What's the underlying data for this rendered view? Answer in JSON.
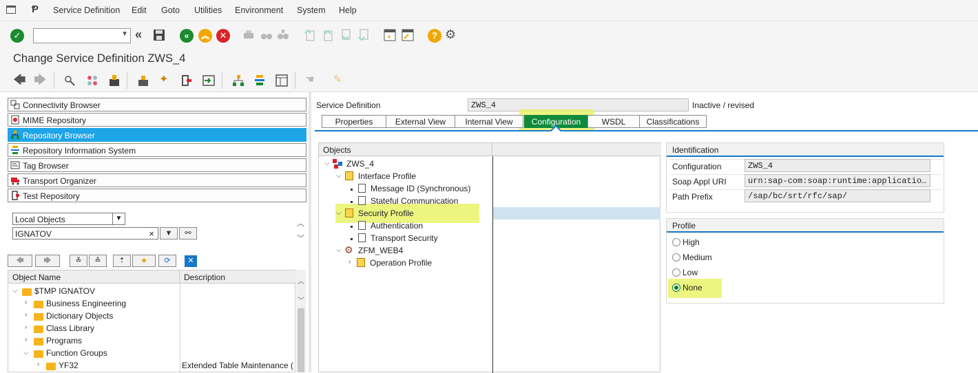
{
  "menu": {
    "items": [
      "Service Definition",
      "Edit",
      "Goto",
      "Utilities",
      "Environment",
      "System",
      "Help"
    ]
  },
  "toolbar": {
    "command_value": "",
    "icons": [
      "enter-icon",
      "command-dropdown-icon",
      "back-double-icon",
      "save-icon",
      "back-icon",
      "exit-icon",
      "cancel-icon",
      "print-icon",
      "find-icon",
      "find-next-icon",
      "first-page-icon",
      "previous-page-icon",
      "next-page-icon",
      "last-page-icon",
      "new-session-icon",
      "shortcut-icon",
      "help-icon",
      "settings-gear-icon"
    ]
  },
  "title": "Change Service Definition ZWS_4",
  "app_toolbar": {
    "icons": [
      "back-arrow-icon",
      "forward-arrow-icon",
      "other-object-icon",
      "display-change-icon",
      "activate-icon",
      "check-icon",
      "where-used-icon",
      "object-list-icon",
      "hierarchy-icon",
      "navigation-window-icon",
      "info-icon",
      "edit-lock-icon"
    ]
  },
  "nav": {
    "items": [
      {
        "label": "Connectivity Browser",
        "icon": "connectivity-icon"
      },
      {
        "label": "MIME Repository",
        "icon": "mime-icon"
      },
      {
        "label": "Repository Browser",
        "icon": "repository-icon"
      },
      {
        "label": "Repository Information System",
        "icon": "info-system-icon"
      },
      {
        "label": "Tag Browser",
        "icon": "tag-icon"
      },
      {
        "label": "Transport Organizer",
        "icon": "transport-icon"
      },
      {
        "label": "Test Repository",
        "icon": "test-icon"
      }
    ],
    "object_type_value": "Local Objects",
    "object_name_value": "IGNATOV",
    "clear_symbol": "×"
  },
  "left_tree": {
    "col_object": "Object Name",
    "col_description": "Description",
    "rows": [
      {
        "label": "$TMP IGNATOV",
        "desc": ""
      },
      {
        "label": "Business Engineering",
        "desc": ""
      },
      {
        "label": "Dictionary Objects",
        "desc": ""
      },
      {
        "label": "Class Library",
        "desc": ""
      },
      {
        "label": "Programs",
        "desc": ""
      },
      {
        "label": "Function Groups",
        "desc": ""
      },
      {
        "label": "YF32",
        "desc": "Extended Table Maintenance ("
      }
    ]
  },
  "header": {
    "label": "Service Definition",
    "value": "ZWS_4",
    "status": "Inactive / revised"
  },
  "tabs": [
    "Properties",
    "External View",
    "Internal View",
    "Configuration",
    "WSDL",
    "Classifications"
  ],
  "objects": {
    "header": "Objects",
    "rows": [
      "ZWS_4",
      "Interface Profile",
      "Message ID (Synchronous)",
      "Stateful Communication",
      "Security Profile",
      "Authentication",
      "Transport Security",
      "ZFM_WEB4",
      "Operation Profile"
    ]
  },
  "identification": {
    "title": "Identification",
    "fields": [
      {
        "label": "Configuration",
        "value": "ZWS_4"
      },
      {
        "label": "Soap Appl URI",
        "value": "urn:sap-com:soap:runtime:application:"
      },
      {
        "label": "Path Prefix",
        "value": "/sap/bc/srt/rfc/sap/"
      }
    ]
  },
  "profile": {
    "title": "Profile",
    "options": [
      "High",
      "Medium",
      "Low",
      "None"
    ],
    "selected": "None"
  },
  "colors": {
    "accent_blue": "#1677c8",
    "selected_nav": "#1ea5e8",
    "active_tab": "#0e8a3a",
    "highlight": "#e9f36a"
  }
}
